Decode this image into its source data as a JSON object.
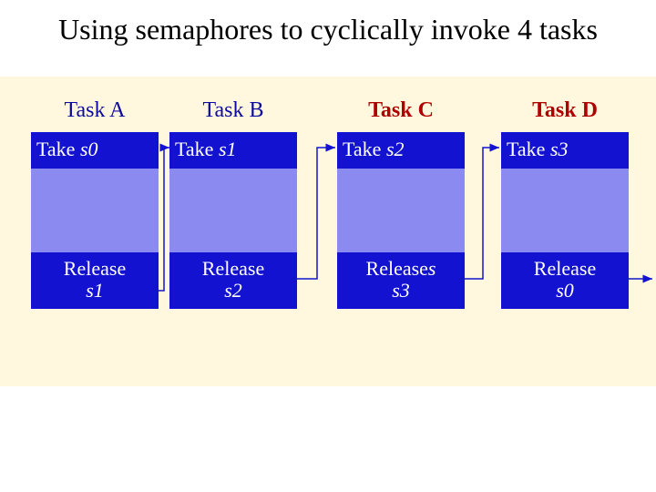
{
  "title": "Using semaphores to cyclically invoke 4 tasks",
  "tasks": {
    "a": {
      "name": "Task A",
      "take": "Take s0",
      "release": "Release s1"
    },
    "b": {
      "name": "Task B",
      "take": "Take s1",
      "release": "Release s2"
    },
    "c": {
      "name": "Task C",
      "take": "Take s2",
      "release": "Releases s3"
    },
    "d": {
      "name": "Task D",
      "take": "Take s3",
      "release": "Release s0"
    }
  },
  "colors": {
    "background": "#fff8df",
    "block": "#1212d0",
    "gap": "#8a8af0",
    "label_blue": "#0d0aa0",
    "label_red": "#b00000"
  }
}
